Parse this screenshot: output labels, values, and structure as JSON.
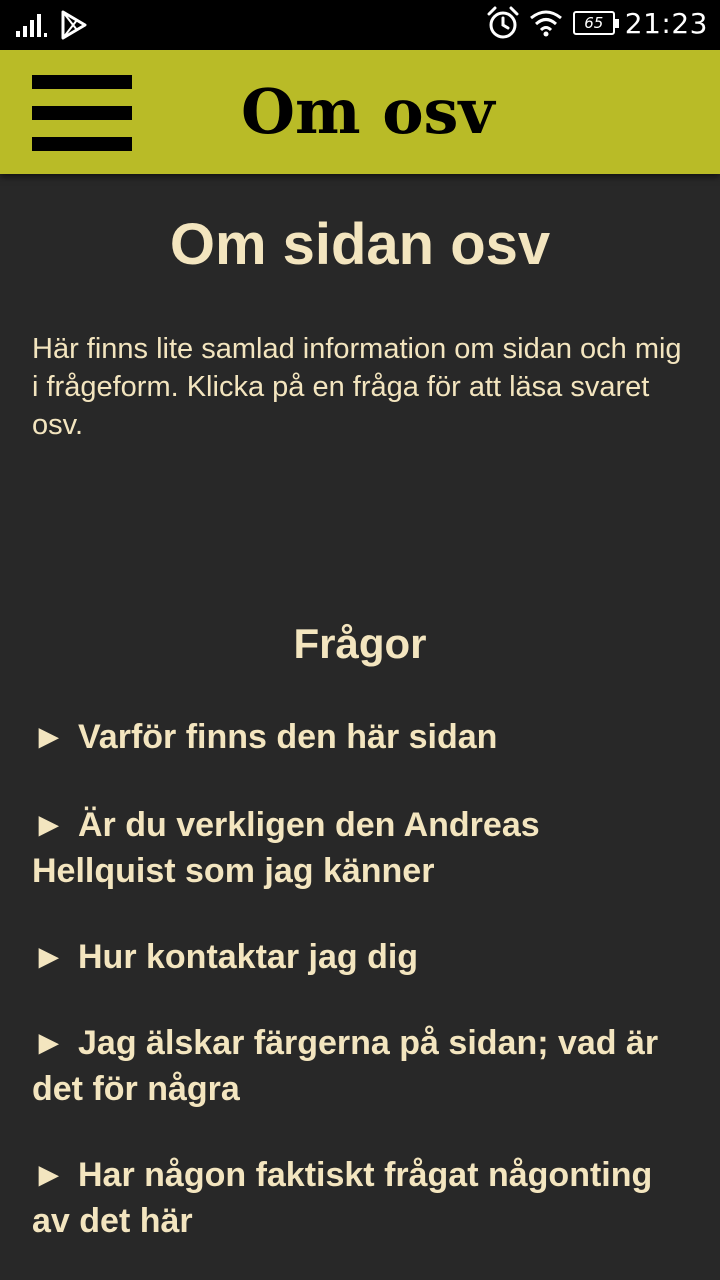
{
  "status_bar": {
    "time": "21:23",
    "battery": "65",
    "icons": [
      "signal-icon",
      "play-store-icon",
      "alarm-icon",
      "wifi-icon",
      "battery-icon"
    ]
  },
  "app_bar": {
    "title": "Om osv",
    "color": "#b9bb27",
    "menu_icon": "hamburger-menu-icon"
  },
  "page": {
    "title": "Om sidan osv",
    "intro": "Här finns lite samlad information om sidan och mig i frågeform. Klicka på en fråga för att läsa svaret osv.",
    "questions_heading": "Frågor",
    "text_color": "#f3e5bf",
    "background": "#282828",
    "questions": [
      {
        "marker": "►",
        "text": "Varför finns den här sidan"
      },
      {
        "marker": "►",
        "text": "Är du verkligen den Andreas Hellquist som jag känner"
      },
      {
        "marker": "►",
        "text": "Hur kontaktar jag dig"
      },
      {
        "marker": "►",
        "text": "Jag älskar färgerna på sidan; vad är det för några"
      },
      {
        "marker": "►",
        "text": "Har någon faktiskt frågat någonting av det här"
      }
    ]
  }
}
